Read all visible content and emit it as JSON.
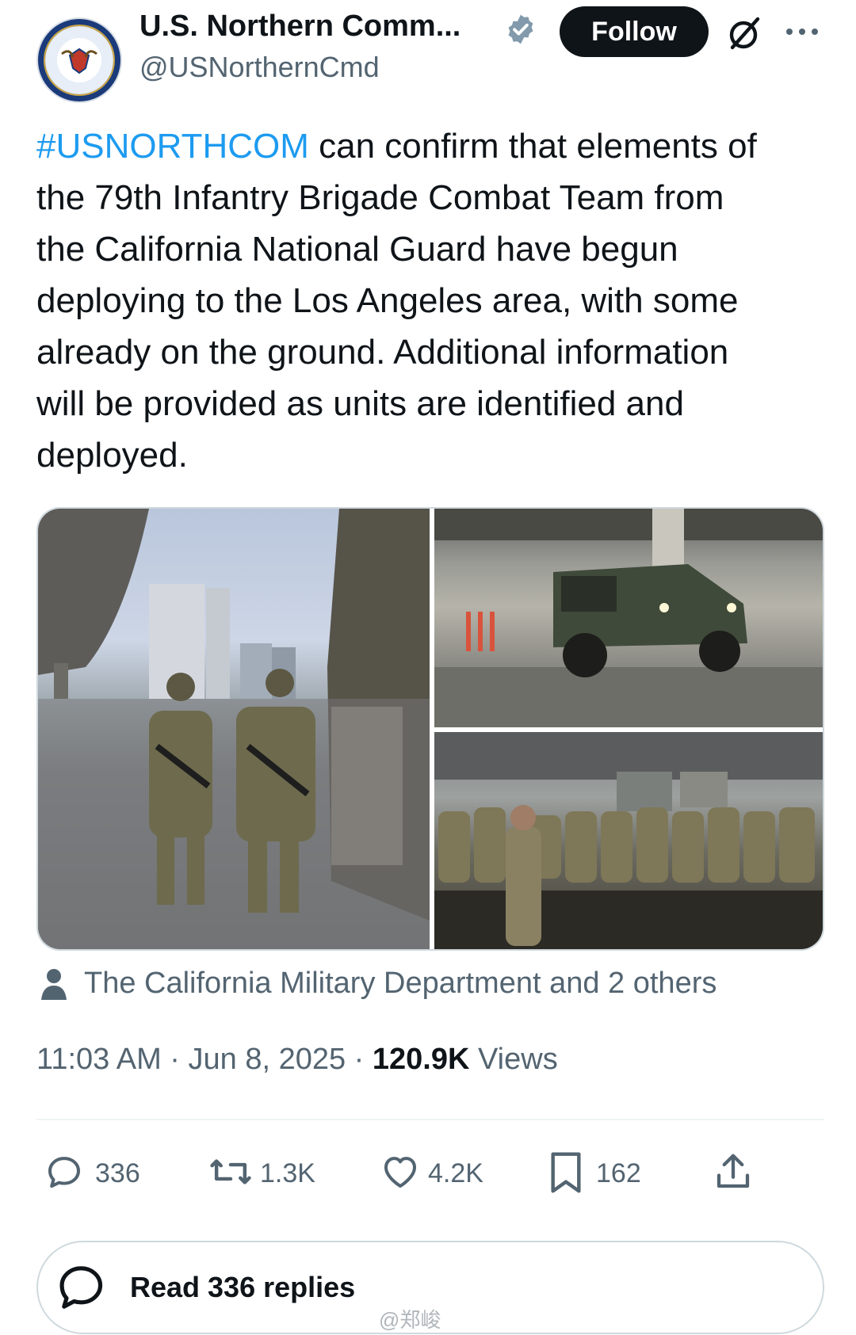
{
  "header": {
    "display_name": "U.S. Northern Comm...",
    "handle": "@USNorthernCmd",
    "follow_label": "Follow"
  },
  "tweet": {
    "hashtag": "#USNORTHCOM",
    "line1": " can confirm that elements of",
    "line2": "the 79th Infantry Brigade Combat Team from",
    "line3": "the California National Guard have begun",
    "line4": "deploying to the Los Angeles area, with some",
    "line5": "already on the ground. Additional information",
    "line6": "will be provided as units are identified and",
    "line7": "deployed."
  },
  "tagged": "The California Military Department and 2 others",
  "meta": {
    "time": "11:03 AM",
    "date": "Jun 8, 2025",
    "views_count": "120.9K",
    "views_label": "Views",
    "sep": " · "
  },
  "actions": {
    "replies": "336",
    "reposts": "1.3K",
    "likes": "4.2K",
    "bookmarks": "162"
  },
  "read_replies_label": "Read 336 replies",
  "watermark": "@郑峻",
  "icons": [
    "verified-badge-icon",
    "grok-icon",
    "more-icon",
    "person-icon",
    "reply-icon",
    "repost-icon",
    "like-icon",
    "bookmark-icon",
    "share-icon",
    "chat-bubble-icon"
  ],
  "colors": {
    "link": "#1d9bf0",
    "secondary": "#536471",
    "primary": "#0f1419",
    "verified": "#829aab"
  }
}
